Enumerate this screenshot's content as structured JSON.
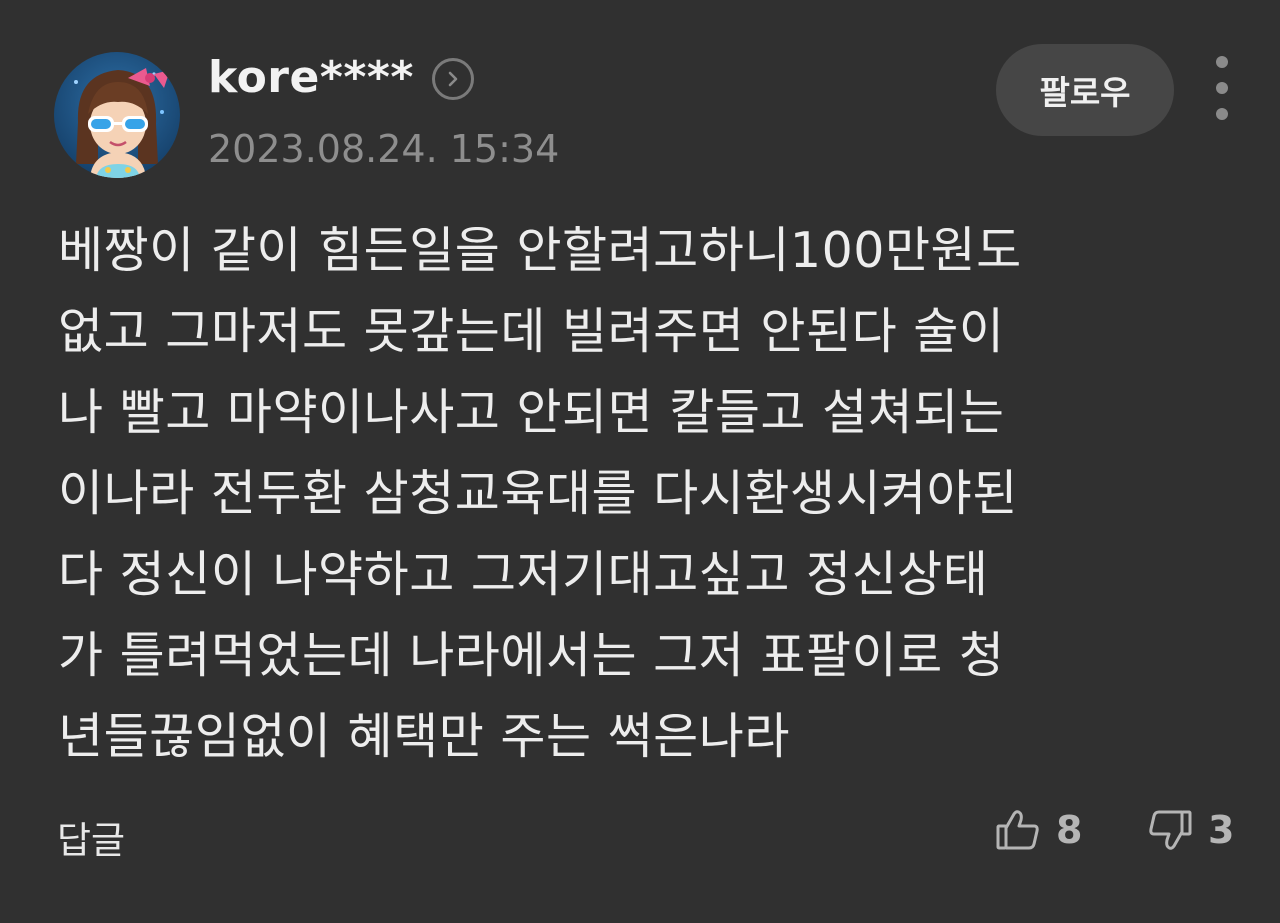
{
  "comment": {
    "author": "kore****",
    "timestamp": "2023.08.24. 15:34",
    "follow_label": "팔로우",
    "lines": [
      "베짱이 같이 힘든일을 안할려고하니100만원도",
      "없고 그마저도 못갚는데 빌려주면 안된다 술이",
      "나 빨고 마약이나사고 안되면 칼들고 설쳐되는",
      "이나라 전두환 삼청교육대를 다시환생시켜야된",
      "다 정신이 나약하고 그저기대고싶고 정신상태",
      "가 틀려먹었는데 나라에서는 그저 표팔이로 청",
      "년들끊임없이 혜택만 주는 썩은나라"
    ],
    "reply_label": "답글",
    "likes": "8",
    "dislikes": "3"
  },
  "icons": {
    "profile": "chevron-right-circle-icon",
    "more": "vertical-ellipsis-icon",
    "like": "thumbs-up-icon",
    "dislike": "thumbs-down-icon"
  },
  "colors": {
    "background": "#303030",
    "button": "#464646",
    "muted_text": "#8e8e8e"
  }
}
